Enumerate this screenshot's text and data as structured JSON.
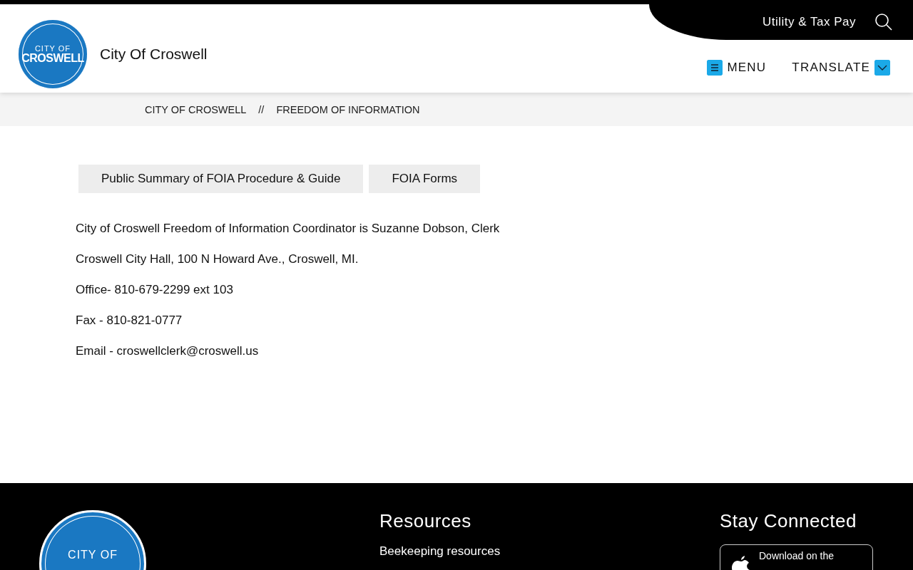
{
  "header": {
    "logo": {
      "line_1": "CITY OF",
      "line_2": "CROSWELL"
    },
    "site_title": "City Of Croswell",
    "utility_link": "Utility & Tax Pay",
    "menu_label": "MENU",
    "translate_label": "TRANSLATE"
  },
  "breadcrumb": [
    "CITY OF CROSWELL",
    "FREEDOM OF INFORMATION"
  ],
  "breadcrumb_separator": "//",
  "buttons": [
    "Public Summary of FOIA Procedure & Guide",
    "FOIA Forms"
  ],
  "paragraphs": [
    "City of Croswell Freedom of Information Coordinator is Suzanne Dobson, Clerk",
    "Croswell City Hall, 100 N Howard Ave., Croswell, MI.",
    "Office- 810-679-2299 ext 103",
    "Fax - 810-821-0777",
    "Email - croswellclerk@croswell.us"
  ],
  "footer": {
    "logo": {
      "line_1": "CITY OF"
    },
    "resources": {
      "heading": "Resources",
      "links": [
        "Beekeeping resources"
      ]
    },
    "connect": {
      "heading": "Stay Connected",
      "app_badge": {
        "small": "Download on the"
      }
    }
  }
}
